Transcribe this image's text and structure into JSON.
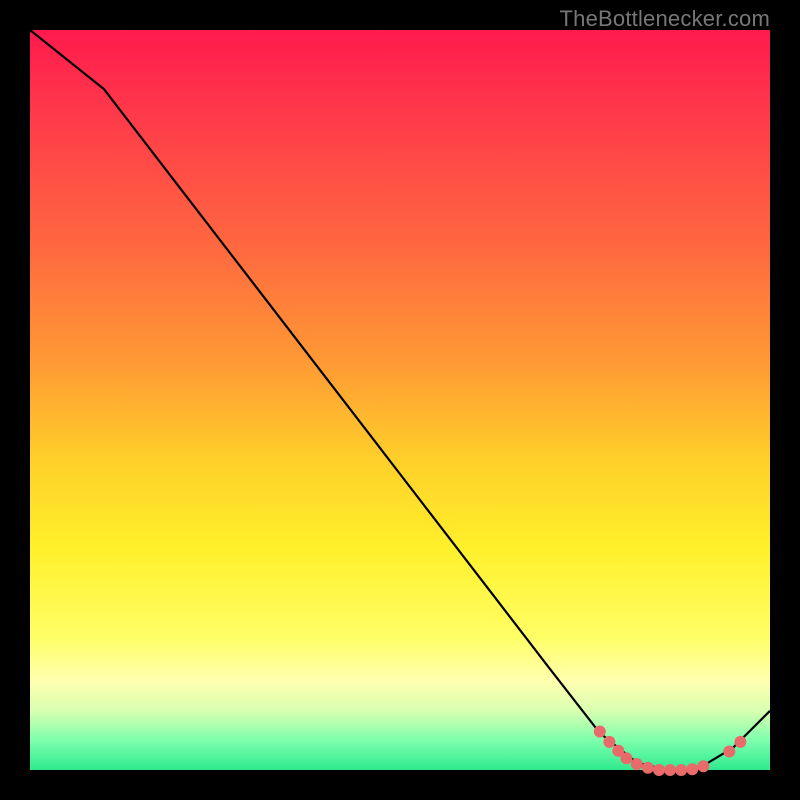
{
  "attribution": "TheBottlenecker.com",
  "chart_data": {
    "type": "line",
    "title": "",
    "xlabel": "",
    "ylabel": "",
    "xlim": [
      0,
      100
    ],
    "ylim": [
      0,
      100
    ],
    "series": [
      {
        "name": "curve",
        "x": [
          0,
          10,
          20,
          30,
          40,
          50,
          60,
          70,
          77,
          82,
          86,
          90,
          95,
          100
        ],
        "y": [
          100,
          92,
          79,
          66,
          53,
          40,
          27,
          14,
          5,
          1,
          0,
          0,
          3,
          8
        ]
      }
    ],
    "markers": [
      {
        "x": 77.0,
        "y": 5.2
      },
      {
        "x": 78.3,
        "y": 3.8
      },
      {
        "x": 79.5,
        "y": 2.6
      },
      {
        "x": 80.6,
        "y": 1.6
      },
      {
        "x": 82.0,
        "y": 0.8
      },
      {
        "x": 83.5,
        "y": 0.3
      },
      {
        "x": 85.0,
        "y": 0.0
      },
      {
        "x": 86.5,
        "y": 0.0
      },
      {
        "x": 88.0,
        "y": 0.0
      },
      {
        "x": 89.5,
        "y": 0.1
      },
      {
        "x": 91.0,
        "y": 0.5
      },
      {
        "x": 94.5,
        "y": 2.5
      },
      {
        "x": 96.0,
        "y": 3.8
      }
    ],
    "colors": {
      "curve": "#000000",
      "marker": "#e86a6a"
    }
  }
}
